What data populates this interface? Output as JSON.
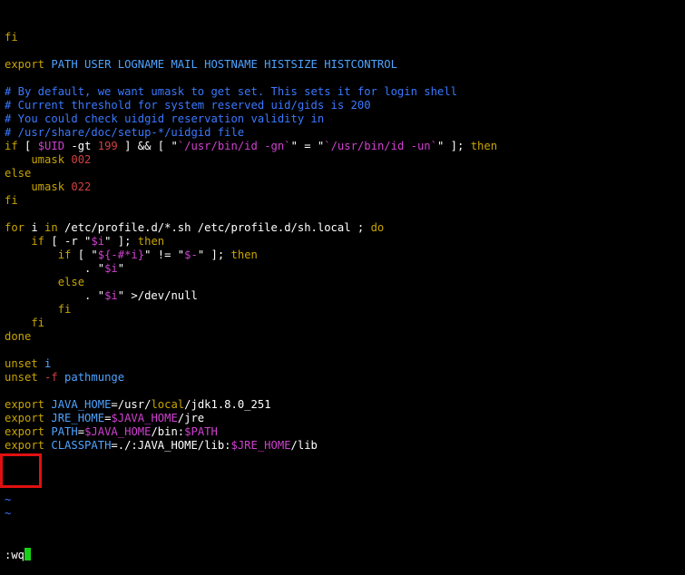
{
  "editor": {
    "mode": "vim",
    "lines": [
      {
        "segments": [
          {
            "t": "fi",
            "c": "kw"
          }
        ]
      },
      {
        "segments": []
      },
      {
        "segments": [
          {
            "t": "export ",
            "c": "kw"
          },
          {
            "t": "PATH USER LOGNAME MAIL HOSTNAME HISTSIZE HISTCONTROL",
            "c": "var"
          }
        ]
      },
      {
        "segments": []
      },
      {
        "segments": [
          {
            "t": "# By default, we want umask to get set. This sets it for login shell",
            "c": "com"
          }
        ]
      },
      {
        "segments": [
          {
            "t": "# Current threshold for system reserved uid/gids is 200",
            "c": "com"
          }
        ]
      },
      {
        "segments": [
          {
            "t": "# You could check uidgid reservation validity in",
            "c": "com"
          }
        ]
      },
      {
        "segments": [
          {
            "t": "# /usr/share/doc/setup-*/uidgid file",
            "c": "com"
          }
        ]
      },
      {
        "segments": [
          {
            "t": "if",
            "c": "kw"
          },
          {
            "t": " [ ",
            "c": "wht"
          },
          {
            "t": "$UID",
            "c": "mag"
          },
          {
            "t": " -gt ",
            "c": "wht"
          },
          {
            "t": "199",
            "c": "str"
          },
          {
            "t": " ] && [ \"",
            "c": "wht"
          },
          {
            "t": "`/usr/bin/id -gn`",
            "c": "mag"
          },
          {
            "t": "\" = \"",
            "c": "wht"
          },
          {
            "t": "`/usr/bin/id -un`",
            "c": "mag"
          },
          {
            "t": "\" ]; ",
            "c": "wht"
          },
          {
            "t": "then",
            "c": "kw"
          }
        ]
      },
      {
        "segments": [
          {
            "t": "    umask ",
            "c": "kw"
          },
          {
            "t": "002",
            "c": "str"
          }
        ]
      },
      {
        "segments": [
          {
            "t": "else",
            "c": "kw"
          }
        ]
      },
      {
        "segments": [
          {
            "t": "    umask ",
            "c": "kw"
          },
          {
            "t": "022",
            "c": "str"
          }
        ]
      },
      {
        "segments": [
          {
            "t": "fi",
            "c": "kw"
          }
        ]
      },
      {
        "segments": []
      },
      {
        "segments": [
          {
            "t": "for",
            "c": "kw"
          },
          {
            "t": " i ",
            "c": "wht"
          },
          {
            "t": "in",
            "c": "kw"
          },
          {
            "t": " /etc/profile.d/*.sh /etc/profile.d/sh.local ; ",
            "c": "wht"
          },
          {
            "t": "do",
            "c": "kw"
          }
        ]
      },
      {
        "segments": [
          {
            "t": "    if",
            "c": "kw"
          },
          {
            "t": " [ -r \"",
            "c": "wht"
          },
          {
            "t": "$i",
            "c": "mag"
          },
          {
            "t": "\" ]; ",
            "c": "wht"
          },
          {
            "t": "then",
            "c": "kw"
          }
        ]
      },
      {
        "segments": [
          {
            "t": "        if",
            "c": "kw"
          },
          {
            "t": " [ \"",
            "c": "wht"
          },
          {
            "t": "${-#*i}",
            "c": "mag"
          },
          {
            "t": "\" != \"",
            "c": "wht"
          },
          {
            "t": "$-",
            "c": "mag"
          },
          {
            "t": "\" ]; ",
            "c": "wht"
          },
          {
            "t": "then",
            "c": "kw"
          }
        ]
      },
      {
        "segments": [
          {
            "t": "            . \"",
            "c": "wht"
          },
          {
            "t": "$i",
            "c": "mag"
          },
          {
            "t": "\"",
            "c": "wht"
          }
        ]
      },
      {
        "segments": [
          {
            "t": "        else",
            "c": "kw"
          }
        ]
      },
      {
        "segments": [
          {
            "t": "            . \"",
            "c": "wht"
          },
          {
            "t": "$i",
            "c": "mag"
          },
          {
            "t": "\" >/dev/null",
            "c": "wht"
          }
        ]
      },
      {
        "segments": [
          {
            "t": "        fi",
            "c": "kw"
          }
        ]
      },
      {
        "segments": [
          {
            "t": "    fi",
            "c": "kw"
          }
        ]
      },
      {
        "segments": [
          {
            "t": "done",
            "c": "kw"
          }
        ]
      },
      {
        "segments": []
      },
      {
        "segments": [
          {
            "t": "unset ",
            "c": "kw"
          },
          {
            "t": "i",
            "c": "var"
          }
        ]
      },
      {
        "segments": [
          {
            "t": "unset ",
            "c": "kw"
          },
          {
            "t": "-f ",
            "c": "str"
          },
          {
            "t": "pathmunge",
            "c": "var"
          }
        ]
      },
      {
        "segments": []
      },
      {
        "segments": [
          {
            "t": "export ",
            "c": "kw"
          },
          {
            "t": "JAVA_HOME",
            "c": "var"
          },
          {
            "t": "=/usr/",
            "c": "wht"
          },
          {
            "t": "local",
            "c": "kw"
          },
          {
            "t": "/jdk1.8.0_251",
            "c": "wht"
          }
        ]
      },
      {
        "segments": [
          {
            "t": "export ",
            "c": "kw"
          },
          {
            "t": "JRE_HOME",
            "c": "var"
          },
          {
            "t": "=",
            "c": "wht"
          },
          {
            "t": "$JAVA_HOME",
            "c": "mag"
          },
          {
            "t": "/jre",
            "c": "wht"
          }
        ]
      },
      {
        "segments": [
          {
            "t": "export ",
            "c": "kw"
          },
          {
            "t": "PATH",
            "c": "var"
          },
          {
            "t": "=",
            "c": "wht"
          },
          {
            "t": "$JAVA_HOME",
            "c": "mag"
          },
          {
            "t": "/bin:",
            "c": "wht"
          },
          {
            "t": "$PATH",
            "c": "mag"
          }
        ]
      },
      {
        "segments": [
          {
            "t": "export ",
            "c": "kw"
          },
          {
            "t": "CLASSPATH",
            "c": "var"
          },
          {
            "t": "=./:JAVA_HOME/lib:",
            "c": "wht"
          },
          {
            "t": "$JRE_HOME",
            "c": "mag"
          },
          {
            "t": "/lib",
            "c": "wht"
          }
        ]
      }
    ],
    "tilde_lines": [
      "~",
      "~",
      "~"
    ],
    "command_line": ":wq"
  },
  "colors": {
    "background": "#000000",
    "keyword": "#c8a400",
    "variable": "#4fa3ff",
    "comment": "#3b78ff",
    "string_number": "#d04040",
    "expansion": "#d040d0",
    "cursor": "#18d018",
    "highlight_box": "#e01010"
  }
}
